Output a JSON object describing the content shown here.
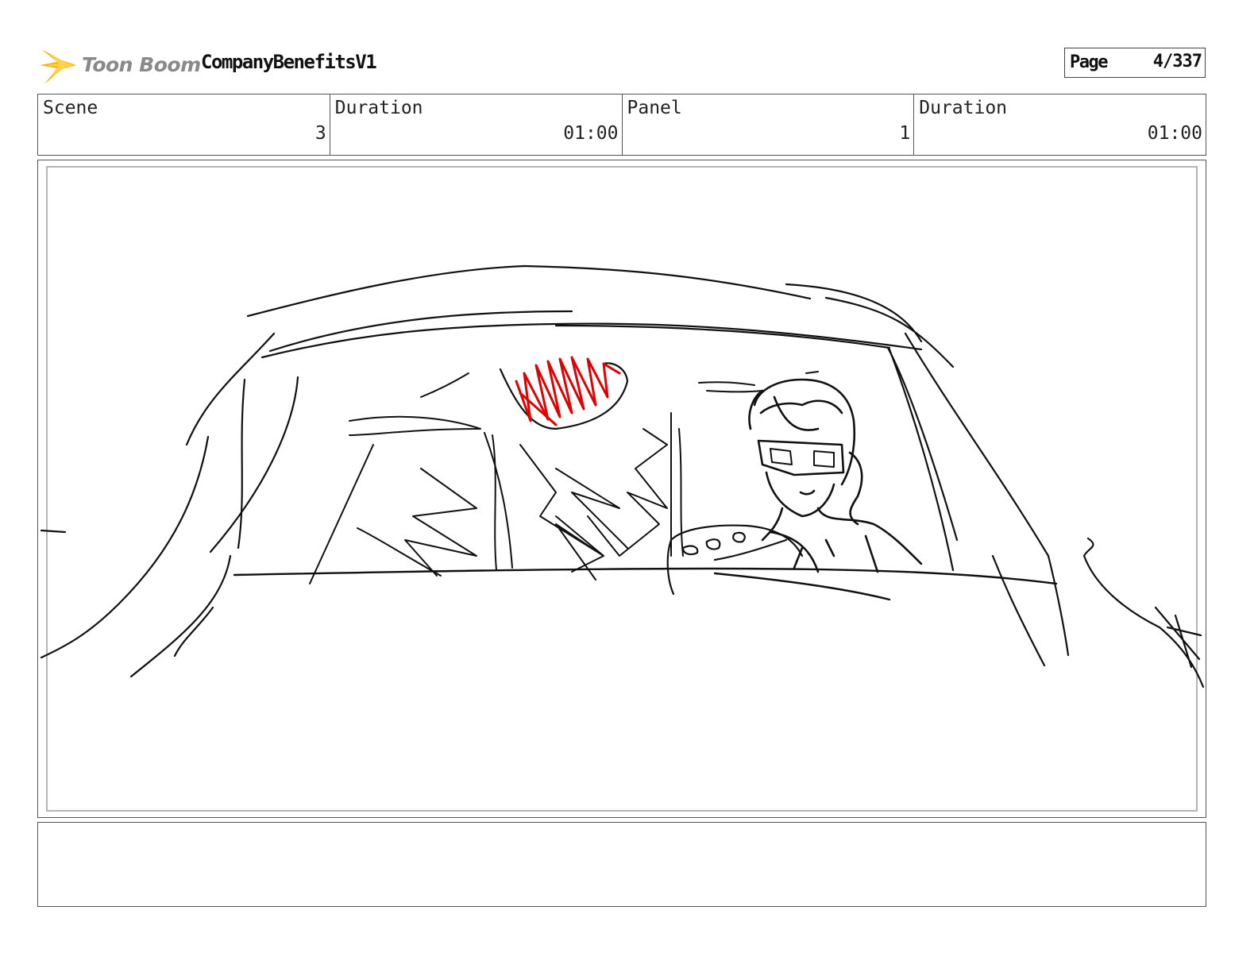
{
  "header": {
    "logo_text": "Toon Boom",
    "project_title": "CompanyBenefitsV1",
    "page_label": "Page",
    "page_value": "4/337"
  },
  "info": [
    {
      "label": "Scene",
      "value": "3"
    },
    {
      "label": "Duration",
      "value": "01:00"
    },
    {
      "label": "Panel",
      "value": "1"
    },
    {
      "label": "Duration",
      "value": "01:00"
    }
  ],
  "notes": {
    "text": ""
  },
  "colors": {
    "accent_logo": "#f7b500",
    "sketch_line": "#111111",
    "sketch_highlight": "#e00000"
  }
}
